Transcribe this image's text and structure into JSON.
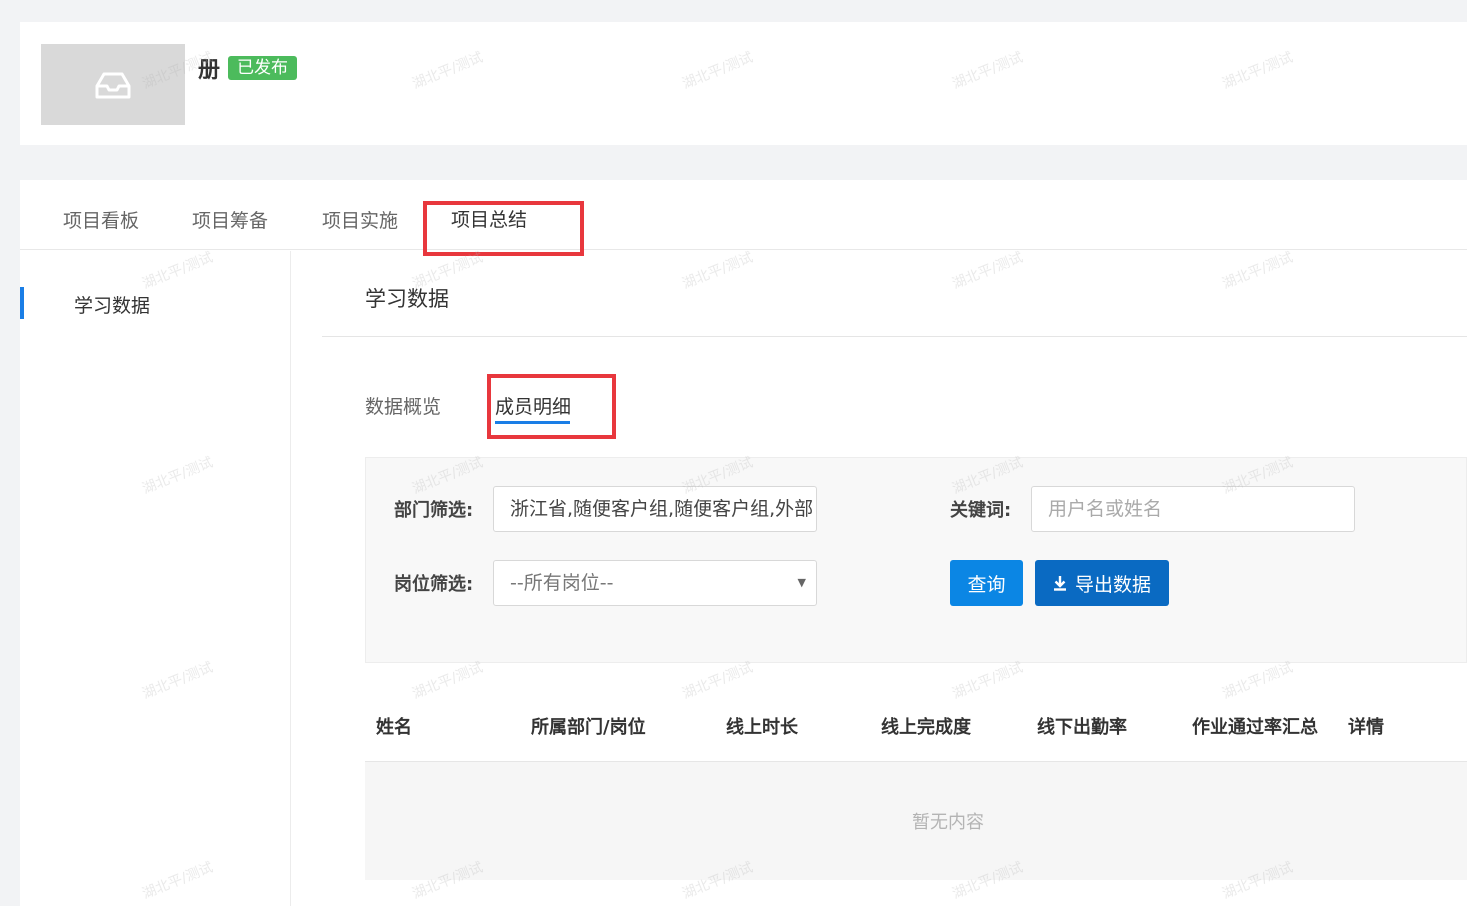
{
  "header": {
    "title": "册",
    "status_badge": "已发布"
  },
  "tabs": [
    {
      "label": "项目看板",
      "active": false
    },
    {
      "label": "项目筹备",
      "active": false
    },
    {
      "label": "项目实施",
      "active": false
    },
    {
      "label": "项目总结",
      "active": true
    }
  ],
  "sidebar": {
    "items": [
      {
        "label": "学习数据",
        "active": true
      }
    ]
  },
  "section": {
    "title": "学习数据"
  },
  "subtabs": [
    {
      "label": "数据概览",
      "active": false
    },
    {
      "label": "成员明细",
      "active": true
    }
  ],
  "filters": {
    "department_label": "部门筛选:",
    "department_value": "浙江省,随便客户组,随便客户组,外部",
    "keyword_label": "关键词:",
    "keyword_placeholder": "用户名或姓名",
    "position_label": "岗位筛选:",
    "position_value": "--所有岗位--",
    "query_button": "查询",
    "export_button": "导出数据"
  },
  "table": {
    "columns": [
      "姓名",
      "所属部门/岗位",
      "线上时长",
      "线上完成度",
      "线下出勤率",
      "作业通过率汇总",
      "详情"
    ],
    "empty_text": "暂无内容"
  },
  "colors": {
    "accent": "#1a7ee6",
    "badge_green": "#4cbb5c",
    "highlight_red": "#e8373d",
    "query_button": "#0b86e4",
    "export_button": "#0a6ac2"
  },
  "watermark": "湖北平/测试"
}
